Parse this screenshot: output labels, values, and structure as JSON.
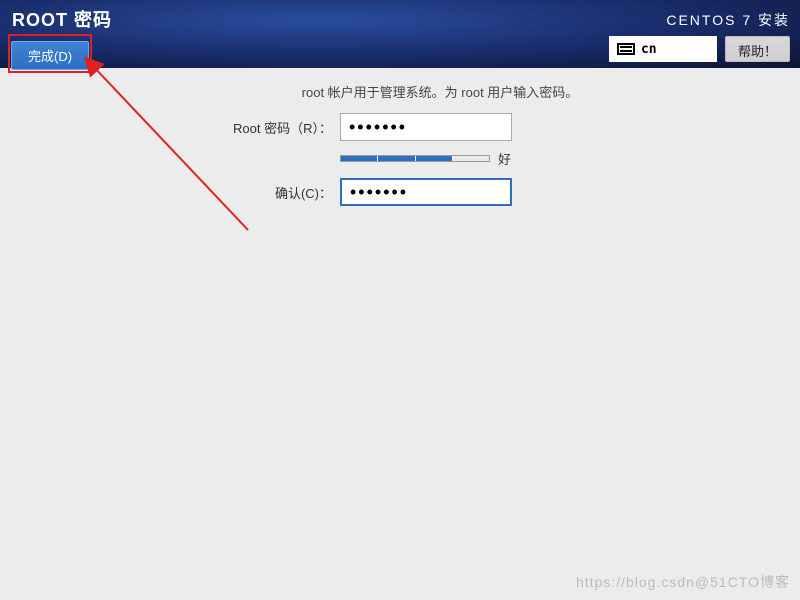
{
  "header": {
    "page_title": "ROOT 密码",
    "done_button": "完成(D)",
    "installer_name": "CENTOS 7 安装",
    "language_code": "cn",
    "help_button": "帮助！"
  },
  "form": {
    "instruction": "root 帐户用于管理系统。为 root 用户输入密码。",
    "password_label": "Root 密码（R）：",
    "password_value": "•••••••",
    "confirm_label": "确认(C)：",
    "confirm_value": "•••••••",
    "strength_label": "好",
    "strength_filled": 3,
    "strength_total": 4
  },
  "watermark": "https://blog.csdn@51CTO博客",
  "colors": {
    "accent": "#2f6fc3",
    "highlight": "#e02020"
  }
}
